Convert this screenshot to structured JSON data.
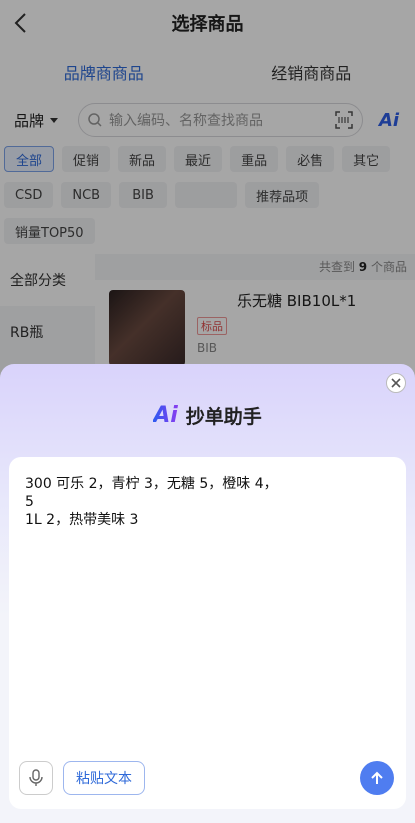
{
  "nav": {
    "title": "选择商品"
  },
  "tabs": [
    {
      "label": "品牌商商品",
      "active": true
    },
    {
      "label": "经销商商品",
      "active": false
    }
  ],
  "search": {
    "brand_label": "品牌",
    "placeholder": "输入编码、名称查找商品",
    "ai_label": "Ai"
  },
  "chips": [
    {
      "label": "全部",
      "active": true
    },
    {
      "label": "促销"
    },
    {
      "label": "新品"
    },
    {
      "label": "最近"
    },
    {
      "label": "重品"
    },
    {
      "label": "必售"
    },
    {
      "label": "其它"
    },
    {
      "label": "CSD"
    },
    {
      "label": "NCB"
    },
    {
      "label": "BIB"
    },
    {
      "label": ""
    },
    {
      "label": "推荐品项"
    },
    {
      "label": "销量TOP50"
    }
  ],
  "categories": [
    {
      "label": "全部分类",
      "active": true
    },
    {
      "label": "RB瓶"
    }
  ],
  "goods": {
    "found_prefix": "共查到",
    "found_count": "9",
    "found_suffix": "个商品",
    "items": [
      {
        "name": "乐无糖 BIB10L*1",
        "tag": "标品",
        "brand": "BIB"
      }
    ]
  },
  "sheet": {
    "title": "抄单助手",
    "logo": "Ai",
    "input_text": "300 可乐 2，青柠 3，无糖 5，橙味 4，\n5\n1L 2，热带美味 3",
    "paste_label": "粘贴文本"
  },
  "colors": {
    "accent": "#2f6ad9",
    "send": "#4f7df0",
    "tag": "#e05050"
  }
}
